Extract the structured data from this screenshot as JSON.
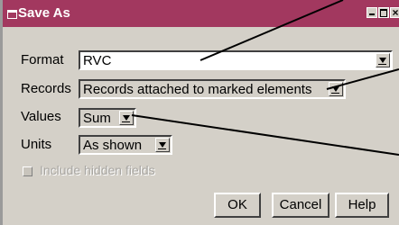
{
  "dialog": {
    "title": "Save As",
    "format": {
      "label": "Format",
      "value": "RVC"
    },
    "records": {
      "label": "Records",
      "value": "Records attached to marked elements"
    },
    "values": {
      "label": "Values",
      "value": "Sum"
    },
    "units": {
      "label": "Units",
      "value": "As shown"
    },
    "include_hidden": {
      "label": "Include hidden fields",
      "checked": false,
      "enabled": false
    },
    "buttons": {
      "ok": "OK",
      "cancel": "Cancel",
      "help": "Help"
    }
  },
  "colors": {
    "titlebar": "#a2385f",
    "dialog_bg": "#d4d0c8",
    "leader_lines": "#000000"
  }
}
